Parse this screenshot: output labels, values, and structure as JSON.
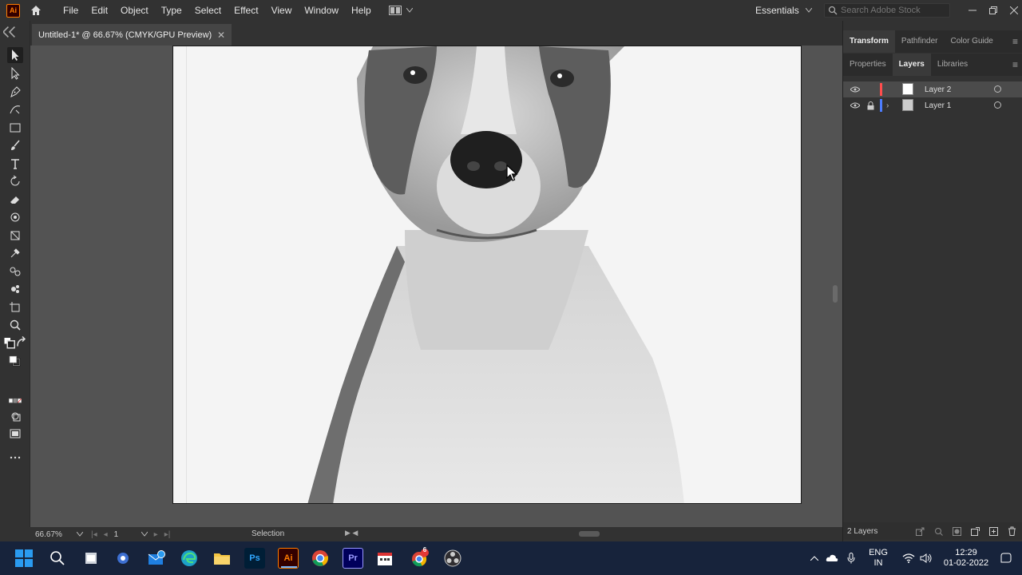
{
  "app": {
    "logo_text": "Ai",
    "menus": [
      "File",
      "Edit",
      "Object",
      "Type",
      "Select",
      "Effect",
      "View",
      "Window",
      "Help"
    ],
    "workspace": "Essentials",
    "search_placeholder": "Search Adobe Stock"
  },
  "document": {
    "tab_title": "Untitled-1* @ 66.67% (CMYK/GPU Preview)"
  },
  "status": {
    "zoom": "66.67%",
    "artboard_number": "1",
    "current_tool": "Selection"
  },
  "panels": {
    "top_tabs": [
      "Transform",
      "Pathfinder",
      "Color Guide"
    ],
    "second_tabs": [
      "Properties",
      "Layers",
      "Libraries"
    ],
    "layers": [
      {
        "name": "Layer 2",
        "color": "#ff4d4d",
        "selected": true
      },
      {
        "name": "Layer 1",
        "color": "#4d7dff",
        "selected": false,
        "locked": true
      }
    ],
    "layer_count": "2 Layers"
  },
  "taskbar": {
    "language": "ENG",
    "region": "IN",
    "time": "12:29",
    "date": "01-02-2022",
    "chrome_badge": "6"
  },
  "colors": {
    "accent": "#ff7c00",
    "taskbar": "#17233b",
    "chrome": "#323232",
    "canvas": "#535353"
  }
}
